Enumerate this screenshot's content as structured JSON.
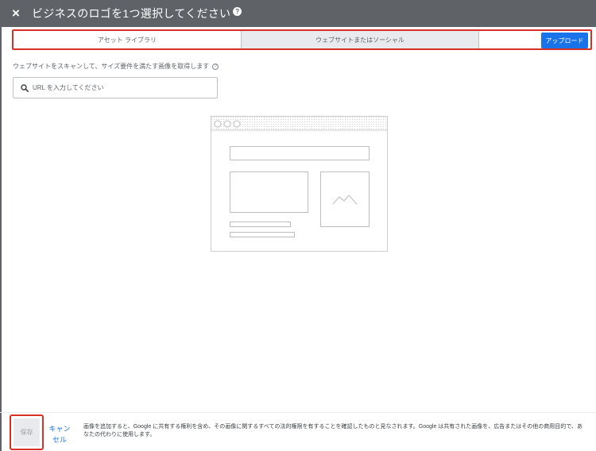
{
  "header": {
    "close_glyph": "×",
    "title": "ビジネスのロゴを1つ選択してください",
    "help_glyph": "?"
  },
  "tabs": [
    {
      "label": "アセット ライブラリ"
    },
    {
      "label": "ウェブサイトまたはソーシャル",
      "selected": true
    }
  ],
  "upload_label": "アップロード",
  "scan": {
    "description": "ウェブサイトをスキャンして、サイズ要件を満たす画像を取得します",
    "help_glyph": "?",
    "input_placeholder": "URL を入力してください",
    "input_value": ""
  },
  "footer": {
    "save_label": "保存",
    "cancel_label": "キャンセル",
    "legal_text": "画像を追加すると、Google に共有する権利を含め、その画像に関するすべての法的権限を有することを確認したものと見なされます。Google は共有された画像を、広告またはその他の商用目的で、あなたの代わりに使用します。"
  },
  "colors": {
    "header_bg": "#5f6368",
    "accent": "#1a73e8",
    "highlight_border": "#d93025",
    "selected_tab_bg": "#e8eaed"
  },
  "icons": {
    "close": "close-icon",
    "help": "help-icon",
    "search": "search-icon",
    "illustration": "website-placeholder-illustration"
  }
}
